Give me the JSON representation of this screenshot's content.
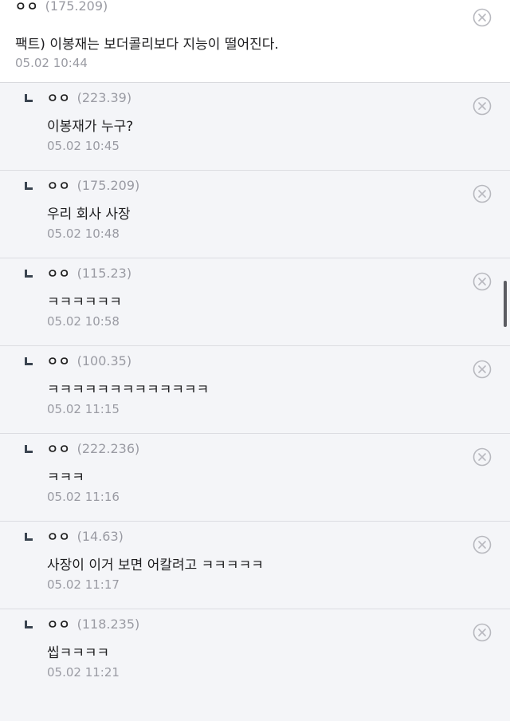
{
  "comments": [
    {
      "type": "top",
      "nick": "ㅇㅇ",
      "ip": "(175.209)",
      "text": "팩트) 이봉재는 보더콜리보다 지능이 떨어진다.",
      "time": "05.02 10:44",
      "delete_icon": "close-circle-icon"
    },
    {
      "type": "reply",
      "nick": "ㅇㅇ",
      "ip": "(223.39)",
      "text": "이봉재가 누구?",
      "time": "05.02 10:45",
      "delete_icon": "close-circle-icon"
    },
    {
      "type": "reply",
      "nick": "ㅇㅇ",
      "ip": "(175.209)",
      "text": "우리 회사 사장",
      "time": "05.02 10:48",
      "delete_icon": "close-circle-icon"
    },
    {
      "type": "reply",
      "nick": "ㅇㅇ",
      "ip": "(115.23)",
      "text": "ㅋㅋㅋㅋㅋㅋ",
      "time": "05.02 10:58",
      "delete_icon": "close-circle-icon"
    },
    {
      "type": "reply",
      "nick": "ㅇㅇ",
      "ip": "(100.35)",
      "text": "ㅋㅋㅋㅋㅋㅋㅋㅋㅋㅋㅋㅋㅋ",
      "time": "05.02 11:15",
      "delete_icon": "close-circle-icon"
    },
    {
      "type": "reply",
      "nick": "ㅇㅇ",
      "ip": "(222.236)",
      "text": "ㅋㅋㅋ",
      "time": "05.02 11:16",
      "delete_icon": "close-circle-icon"
    },
    {
      "type": "reply",
      "nick": "ㅇㅇ",
      "ip": "(14.63)",
      "text": "사장이 이거 보면 어칼려고 ㅋㅋㅋㅋㅋ",
      "time": "05.02 11:17",
      "delete_icon": "close-circle-icon"
    },
    {
      "type": "reply",
      "nick": "ㅇㅇ",
      "ip": "(118.235)",
      "text": "씹ㅋㅋㅋㅋ",
      "time": "05.02 11:21",
      "delete_icon": "close-circle-icon"
    }
  ],
  "icons": {
    "reply": "reply-arrow-icon",
    "delete": "close-circle-icon"
  },
  "colors": {
    "reply_background": "#f4f5f8",
    "meta_gray": "#9a9ba3",
    "divider": "#dcdde2"
  }
}
